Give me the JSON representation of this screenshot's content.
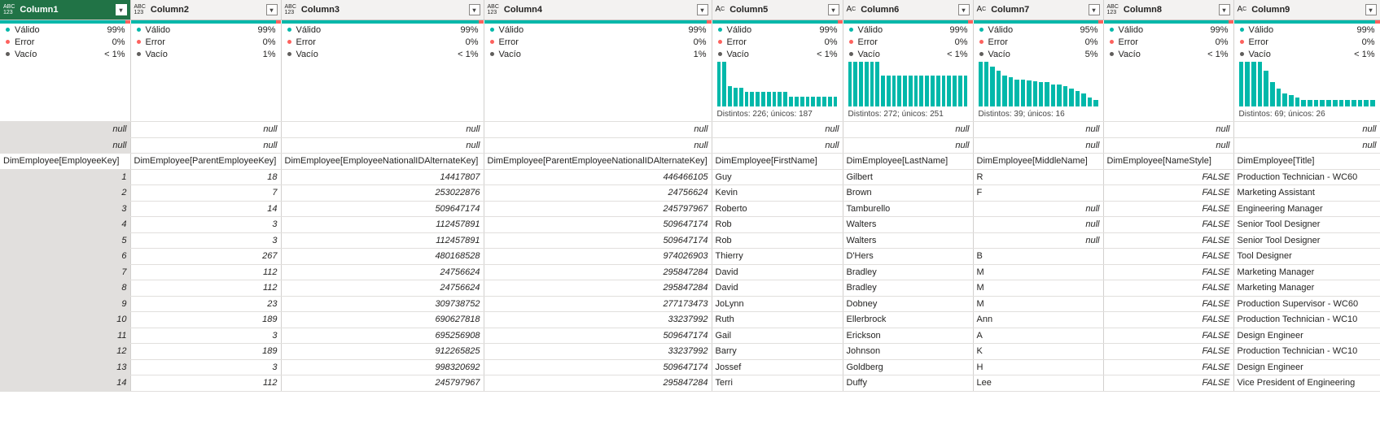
{
  "columns": [
    {
      "name": "Column1",
      "type": "any",
      "type_top": "ABC",
      "type_bottom": "123",
      "selected": true,
      "quality": {
        "valid_label": "Válido",
        "valid": "99%",
        "error_label": "Error",
        "error": "0%",
        "empty_label": "Vacío",
        "empty": "< 1%"
      }
    },
    {
      "name": "Column2",
      "type": "any",
      "type_top": "ABC",
      "type_bottom": "123",
      "quality": {
        "valid_label": "Válido",
        "valid": "99%",
        "error_label": "Error",
        "error": "0%",
        "empty_label": "Vacío",
        "empty": "1%"
      }
    },
    {
      "name": "Column3",
      "type": "any",
      "type_top": "ABC",
      "type_bottom": "123",
      "quality": {
        "valid_label": "Válido",
        "valid": "99%",
        "error_label": "Error",
        "error": "0%",
        "empty_label": "Vacío",
        "empty": "< 1%"
      }
    },
    {
      "name": "Column4",
      "type": "any",
      "type_top": "ABC",
      "type_bottom": "123",
      "quality": {
        "valid_label": "Válido",
        "valid": "99%",
        "error_label": "Error",
        "error": "0%",
        "empty_label": "Vacío",
        "empty": "1%"
      }
    },
    {
      "name": "Column5",
      "type": "text",
      "type_top": "A",
      "type_bottom": "C",
      "quality": {
        "valid_label": "Válido",
        "valid": "99%",
        "error_label": "Error",
        "error": "0%",
        "empty_label": "Vacío",
        "empty": "< 1%"
      },
      "distribution_label": "Distintos: 226; únicos: 187",
      "dist": [
        1.0,
        1.0,
        0.45,
        0.42,
        0.42,
        0.33,
        0.33,
        0.33,
        0.33,
        0.33,
        0.33,
        0.33,
        0.33,
        0.22,
        0.22,
        0.22,
        0.22,
        0.22,
        0.22,
        0.22,
        0.22,
        0.22
      ]
    },
    {
      "name": "Column6",
      "type": "text",
      "type_top": "A",
      "type_bottom": "C",
      "quality": {
        "valid_label": "Válido",
        "valid": "99%",
        "error_label": "Error",
        "error": "0%",
        "empty_label": "Vacío",
        "empty": "< 1%"
      },
      "distribution_label": "Distintos: 272; únicos: 251",
      "dist": [
        1.0,
        1.0,
        1.0,
        1.0,
        1.0,
        1.0,
        0.7,
        0.7,
        0.7,
        0.7,
        0.7,
        0.7,
        0.7,
        0.7,
        0.7,
        0.7,
        0.7,
        0.7,
        0.7,
        0.7,
        0.7,
        0.7
      ]
    },
    {
      "name": "Column7",
      "type": "text",
      "type_top": "A",
      "type_bottom": "C",
      "quality": {
        "valid_label": "Válido",
        "valid": "95%",
        "error_label": "Error",
        "error": "0%",
        "empty_label": "Vacío",
        "empty": "5%"
      },
      "distribution_label": "Distintos: 39; únicos: 16",
      "dist": [
        1.0,
        1.0,
        0.9,
        0.8,
        0.7,
        0.65,
        0.6,
        0.6,
        0.58,
        0.56,
        0.55,
        0.55,
        0.5,
        0.5,
        0.46,
        0.4,
        0.35,
        0.3,
        0.2,
        0.15
      ]
    },
    {
      "name": "Column8",
      "type": "any",
      "type_top": "ABC",
      "type_bottom": "123",
      "quality": {
        "valid_label": "Válido",
        "valid": "99%",
        "error_label": "Error",
        "error": "0%",
        "empty_label": "Vacío",
        "empty": "< 1%"
      }
    },
    {
      "name": "Column9",
      "type": "text",
      "type_top": "A",
      "type_bottom": "C",
      "quality": {
        "valid_label": "Válido",
        "valid": "99%",
        "error_label": "Error",
        "error": "0%",
        "empty_label": "Vacío",
        "empty": "< 1%"
      },
      "distribution_label": "Distintos: 69; únicos: 26",
      "dist": [
        1.0,
        1.0,
        1.0,
        1.0,
        0.8,
        0.55,
        0.4,
        0.3,
        0.25,
        0.2,
        0.15,
        0.15,
        0.15,
        0.15,
        0.15,
        0.15,
        0.15,
        0.15,
        0.15,
        0.15,
        0.15,
        0.15
      ]
    }
  ],
  "rows": [
    {
      "rn": "",
      "cells": [
        "null",
        "null",
        "null",
        "null",
        "null",
        "null",
        "null",
        "null",
        "null"
      ]
    },
    {
      "rn": "",
      "cells": [
        "null",
        "null",
        "null",
        "null",
        "null",
        "null",
        "null",
        "null",
        "null"
      ]
    },
    {
      "rn": "",
      "cells": [
        "DimEmployee[EmployeeKey]",
        "DimEmployee[ParentEmployeeKey]",
        "DimEmployee[EmployeeNationalIDAlternateKey]",
        "DimEmployee[ParentEmployeeNationalIDAlternateKey]",
        "DimEmployee[FirstName]",
        "DimEmployee[LastName]",
        "DimEmployee[MiddleName]",
        "DimEmployee[NameStyle]",
        "DimEmployee[Title]"
      ]
    },
    {
      "rn": "1",
      "cells": [
        "",
        "18",
        "14417807",
        "446466105",
        "Guy",
        "Gilbert",
        "R",
        "FALSE",
        "Production Technician - WC60"
      ]
    },
    {
      "rn": "2",
      "cells": [
        "",
        "7",
        "253022876",
        "24756624",
        "Kevin",
        "Brown",
        "F",
        "FALSE",
        "Marketing Assistant"
      ]
    },
    {
      "rn": "3",
      "cells": [
        "",
        "14",
        "509647174",
        "245797967",
        "Roberto",
        "Tamburello",
        "null",
        "FALSE",
        "Engineering Manager"
      ]
    },
    {
      "rn": "4",
      "cells": [
        "",
        "3",
        "112457891",
        "509647174",
        "Rob",
        "Walters",
        "null",
        "FALSE",
        "Senior Tool Designer"
      ]
    },
    {
      "rn": "5",
      "cells": [
        "",
        "3",
        "112457891",
        "509647174",
        "Rob",
        "Walters",
        "null",
        "FALSE",
        "Senior Tool Designer"
      ]
    },
    {
      "rn": "6",
      "cells": [
        "",
        "267",
        "480168528",
        "974026903",
        "Thierry",
        "D'Hers",
        "B",
        "FALSE",
        "Tool Designer"
      ]
    },
    {
      "rn": "7",
      "cells": [
        "",
        "112",
        "24756624",
        "295847284",
        "David",
        "Bradley",
        "M",
        "FALSE",
        "Marketing Manager"
      ]
    },
    {
      "rn": "8",
      "cells": [
        "",
        "112",
        "24756624",
        "295847284",
        "David",
        "Bradley",
        "M",
        "FALSE",
        "Marketing Manager"
      ]
    },
    {
      "rn": "9",
      "cells": [
        "",
        "23",
        "309738752",
        "277173473",
        "JoLynn",
        "Dobney",
        "M",
        "FALSE",
        "Production Supervisor - WC60"
      ]
    },
    {
      "rn": "10",
      "cells": [
        "",
        "189",
        "690627818",
        "33237992",
        "Ruth",
        "Ellerbrock",
        "Ann",
        "FALSE",
        "Production Technician - WC10"
      ]
    },
    {
      "rn": "11",
      "cells": [
        "",
        "3",
        "695256908",
        "509647174",
        "Gail",
        "Erickson",
        "A",
        "FALSE",
        "Design Engineer"
      ]
    },
    {
      "rn": "12",
      "cells": [
        "",
        "189",
        "912265825",
        "33237992",
        "Barry",
        "Johnson",
        "K",
        "FALSE",
        "Production Technician - WC10"
      ]
    },
    {
      "rn": "13",
      "cells": [
        "",
        "3",
        "998320692",
        "509647174",
        "Jossef",
        "Goldberg",
        "H",
        "FALSE",
        "Design Engineer"
      ]
    },
    {
      "rn": "14",
      "cells": [
        "",
        "112",
        "245797967",
        "295847284",
        "Terri",
        "Duffy",
        "Lee",
        "FALSE",
        "Vice President of Engineering"
      ]
    }
  ]
}
